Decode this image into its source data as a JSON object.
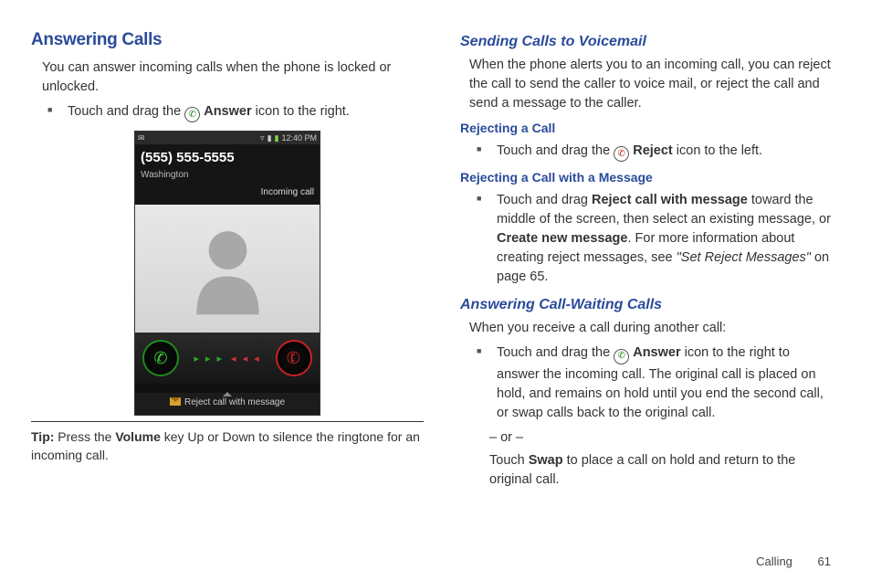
{
  "left": {
    "title": "Answering Calls",
    "intro": "You can answer incoming calls when the phone is locked or unlocked.",
    "bullet_pre": "Touch and drag the ",
    "bullet_bold": "Answer",
    "bullet_post": " icon to the right.",
    "phone": {
      "time": "12:40 PM",
      "number": "(555) 555-5555",
      "location": "Washington",
      "incoming": "Incoming call",
      "reject_msg": "Reject call with message"
    },
    "tip_label": "Tip:",
    "tip_pre": "Press the ",
    "tip_bold": "Volume",
    "tip_post": " key Up or Down to silence the ringtone for an incoming call."
  },
  "right": {
    "h1": "Sending Calls to Voicemail",
    "p1": "When the phone alerts you to an incoming call, you can reject the call to send the caller to voice mail, or reject the call and send a message to the caller.",
    "h2": "Rejecting a Call",
    "b2_pre": "Touch and drag the ",
    "b2_bold": "Reject",
    "b2_post": " icon to the left.",
    "h3": "Rejecting a Call with a Message",
    "b3_pre": "Touch and drag ",
    "b3_bold1": "Reject call with message",
    "b3_mid": " toward the middle of the screen, then select an existing message, or ",
    "b3_bold2": "Create new message",
    "b3_mid2": ". For more information about creating reject messages, see ",
    "b3_ital": "\"Set Reject Messages\"",
    "b3_post": " on page 65.",
    "h4": "Answering Call-Waiting Calls",
    "p4": "When you receive a call during another call:",
    "b4_pre": "Touch and drag the ",
    "b4_bold": "Answer",
    "b4_post": " icon to the right to answer the incoming call. The original call is placed on hold, and remains on hold until you end the second call, or swap calls back to the original call.",
    "or": "– or –",
    "b5_pre": "Touch ",
    "b5_bold": "Swap",
    "b5_post": " to place a call on hold and return to the original call."
  },
  "footer": {
    "section": "Calling",
    "page": "61"
  }
}
